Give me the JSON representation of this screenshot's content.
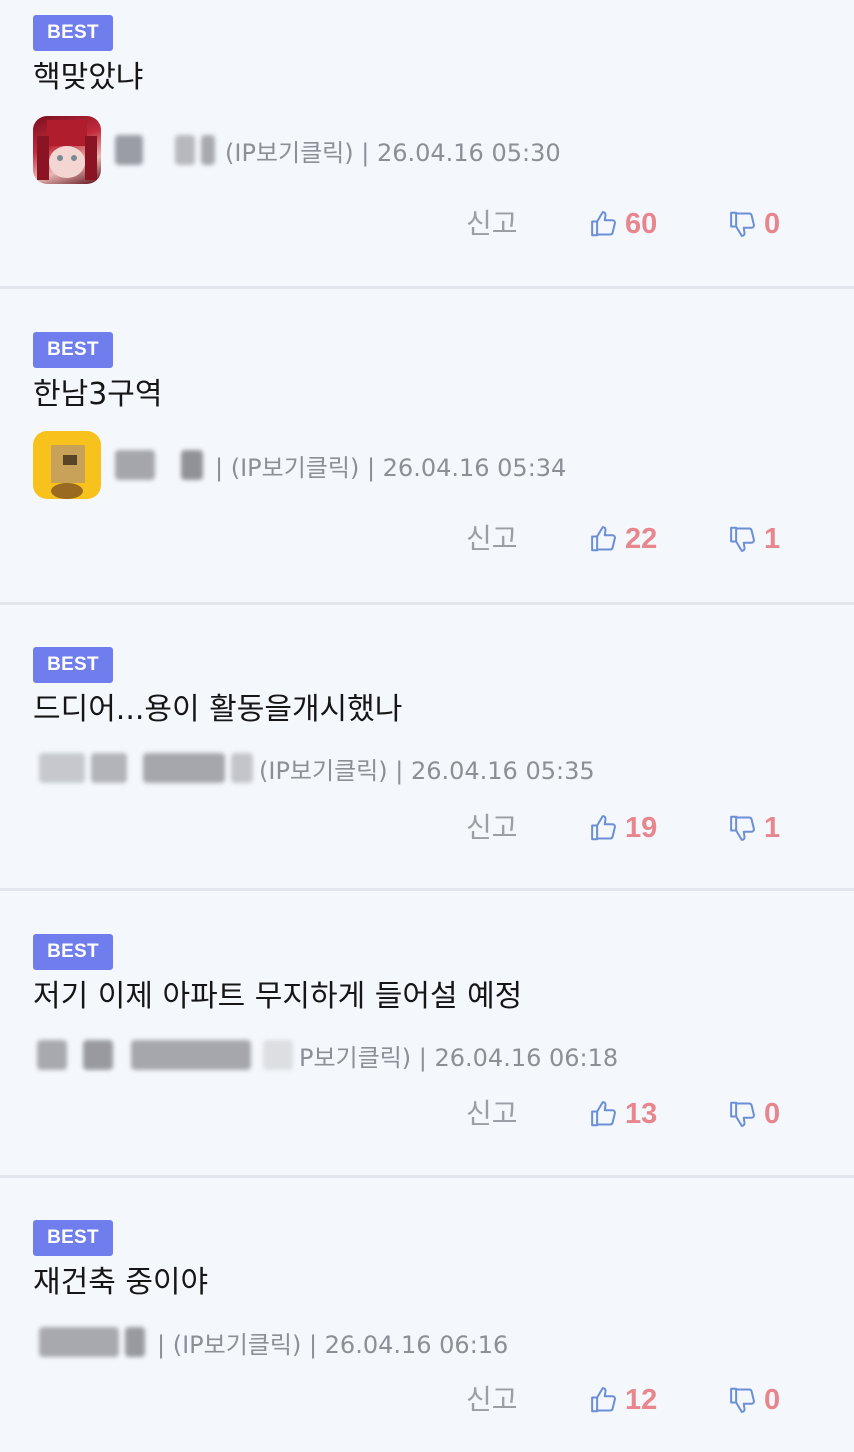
{
  "colors": {
    "background": "#f4f7fc",
    "badge": "#6f7ded",
    "thumb_icon": "#6b8fd6",
    "vote_count": "#e8868d",
    "divider": "#e1e5ec",
    "meta_text": "#8b8f96"
  },
  "icons": {
    "like": "thumbs-up-icon",
    "dislike": "thumbs-down-icon"
  },
  "comments": [
    {
      "badge": "BEST",
      "text": "핵맞았냐",
      "has_avatar": true,
      "meta": "(IP보기클릭) | 26.04.16 05:30",
      "report_label": "신고",
      "likes": "60",
      "dislikes": "0"
    },
    {
      "badge": "BEST",
      "text": "한남3구역",
      "has_avatar": true,
      "meta": "| (IP보기클릭) | 26.04.16 05:34",
      "report_label": "신고",
      "likes": "22",
      "dislikes": "1"
    },
    {
      "badge": "BEST",
      "text": "드디어...용이 활동을개시했나",
      "has_avatar": false,
      "meta": "(IP보기클릭) | 26.04.16 05:35",
      "report_label": "신고",
      "likes": "19",
      "dislikes": "1"
    },
    {
      "badge": "BEST",
      "text": "저기 이제 아파트 무지하게 들어설 예정",
      "has_avatar": false,
      "meta": "P보기클릭) | 26.04.16 06:18",
      "report_label": "신고",
      "likes": "13",
      "dislikes": "0"
    },
    {
      "badge": "BEST",
      "text": "재건축 중이야",
      "has_avatar": false,
      "meta": "| (IP보기클릭) | 26.04.16 06:16",
      "report_label": "신고",
      "likes": "12",
      "dislikes": "0"
    }
  ]
}
